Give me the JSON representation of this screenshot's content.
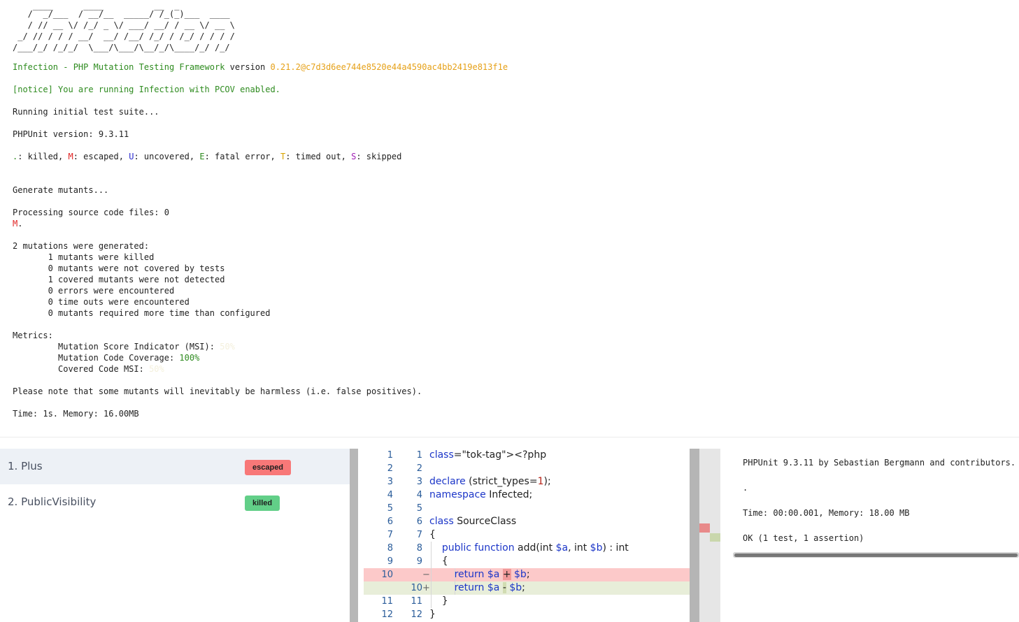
{
  "terminal": {
    "logo_lines": [
      "    ____      ____          __  _",
      "   /  _/___  / __/__  _____/ /_(_)___  ____",
      "   / // __ \\/ /_/ _ \\/ ___/ __/ / __ \\/ __ \\",
      " _/ // / / / __/  __/ /__/ /_/ / /_/ / / / /",
      "/___/_/ /_/_/  \\___/\\___/\\__/_/\\____/_/ /_/"
    ],
    "framework_name": "Infection - PHP Mutation Testing Framework",
    "version_label": "version",
    "version_value": "0.21.2@c7d3d6ee744e8520e44a4590ac4bb2419e813f1e",
    "notice": "[notice] You are running Infection with PCOV enabled.",
    "running_suite": "Running initial test suite...",
    "phpunit_version": "PHPUnit version: 9.3.11",
    "legend": {
      "killed_symbol": ".",
      "killed_text": ": killed, ",
      "escaped_symbol": "M",
      "escaped_text": ": escaped, ",
      "uncovered_symbol": "U",
      "uncovered_text": ": uncovered, ",
      "error_symbol": "E",
      "error_text": ": fatal error, ",
      "timeout_symbol": "T",
      "timeout_text": ": timed out, ",
      "skipped_symbol": "S",
      "skipped_text": ": skipped"
    },
    "generate_mutants": "Generate mutants...",
    "processing_files": "Processing source code files: 0",
    "progress_symbol": "M",
    "progress_dot": ".",
    "generated_summary": "2 mutations were generated:",
    "stats": [
      "       1 mutants were killed",
      "       0 mutants were not covered by tests",
      "       1 covered mutants were not detected",
      "       0 errors were encountered",
      "       0 time outs were encountered",
      "       0 mutants required more time than configured"
    ],
    "metrics_label": "Metrics:",
    "msi_label": "         Mutation Score Indicator (MSI): ",
    "msi_value": "50%",
    "coverage_label": "         Mutation Code Coverage: ",
    "coverage_value": "100%",
    "covered_msi_label": "         Covered Code MSI: ",
    "covered_msi_value": "50%",
    "note": "Please note that some mutants will inevitably be harmless (i.e. false positives).",
    "time_memory": "Time: 1s. Memory: 16.00MB"
  },
  "mutants": [
    {
      "label": "1. Plus",
      "status": "escaped"
    },
    {
      "label": "2. PublicVisibility",
      "status": "killed"
    }
  ],
  "status_colors": {
    "escaped": "#f87878",
    "killed": "#62cf88"
  },
  "diff": {
    "lines": [
      {
        "old": "1",
        "new": "1",
        "sign": "",
        "code": "<?php"
      },
      {
        "old": "2",
        "new": "2",
        "sign": "",
        "code": ""
      },
      {
        "old": "3",
        "new": "3",
        "sign": "",
        "code": "declare (strict_types=1);"
      },
      {
        "old": "4",
        "new": "4",
        "sign": "",
        "code": "namespace Infected;"
      },
      {
        "old": "5",
        "new": "5",
        "sign": "",
        "code": ""
      },
      {
        "old": "6",
        "new": "6",
        "sign": "",
        "code": "class SourceClass"
      },
      {
        "old": "7",
        "new": "7",
        "sign": "",
        "code": "{"
      },
      {
        "old": "8",
        "new": "8",
        "sign": "",
        "code": "    public function add(int $a, int $b) : int"
      },
      {
        "old": "9",
        "new": "9",
        "sign": "",
        "code": "    {"
      },
      {
        "old": "10",
        "new": "",
        "sign": "−",
        "code": "        return $a + $b;"
      },
      {
        "old": "",
        "new": "10",
        "sign": "+",
        "code": "        return $a - $b;"
      },
      {
        "old": "11",
        "new": "11",
        "sign": "",
        "code": "    }"
      },
      {
        "old": "12",
        "new": "12",
        "sign": "",
        "code": "}"
      }
    ]
  },
  "test_output": {
    "lines": [
      "PHPUnit 9.3.11 by Sebastian Bergmann and contributors.",
      "",
      ".",
      "",
      "Time: 00:00.001, Memory: 18.00 MB",
      "",
      "OK (1 test, 1 assertion)"
    ]
  }
}
